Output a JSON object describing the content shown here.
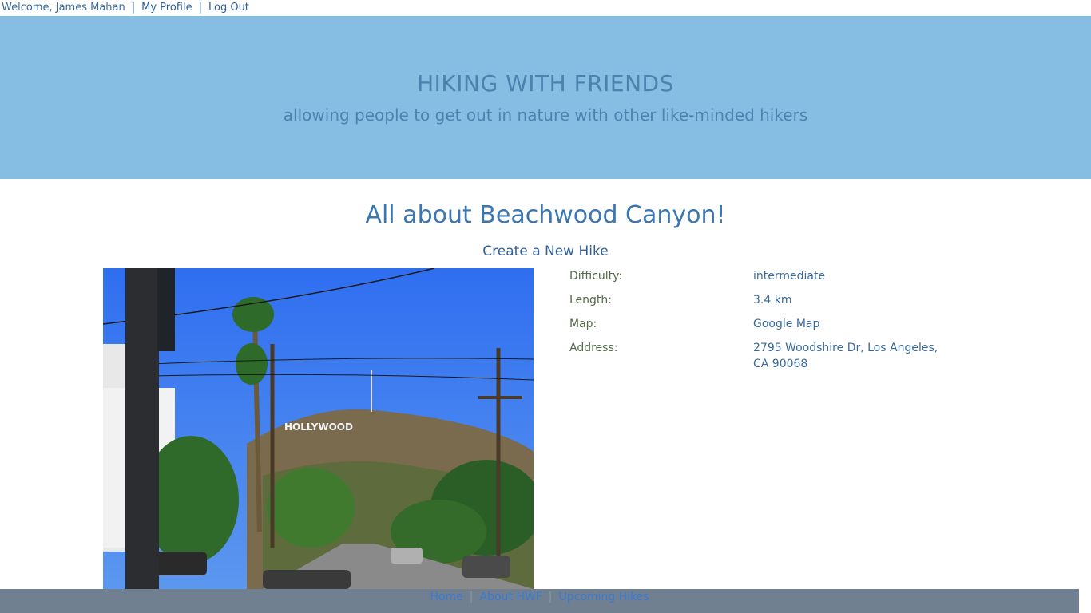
{
  "topbar": {
    "welcome": "Welcome, James Mahan",
    "separator": "|",
    "profile_link": "My Profile",
    "logout_link": "Log Out"
  },
  "banner": {
    "title": "HIKING WITH FRIENDS",
    "tagline": "allowing people to get out in nature with other like-minded hikers"
  },
  "page": {
    "heading": "All about Beachwood Canyon!",
    "create_hike_link": "Create a New Hike"
  },
  "photo": {
    "sign_text": "HOLLYWOOD"
  },
  "details": [
    {
      "label": "Difficulty:",
      "value": "intermediate"
    },
    {
      "label": "Length:",
      "value": "3.4 km"
    },
    {
      "label": "Map:",
      "value": "Google Map"
    },
    {
      "label": "Address:",
      "value": "2795 Woodshire Dr, Los Angeles, CA 90068"
    }
  ],
  "footer": {
    "home": "Home",
    "about": "About HWF",
    "upcoming": "Upcoming Hikes",
    "separator": "|"
  },
  "colors": {
    "banner_bg": "#86bee3",
    "footer_bg": "#708090",
    "link": "#2f5f95"
  }
}
